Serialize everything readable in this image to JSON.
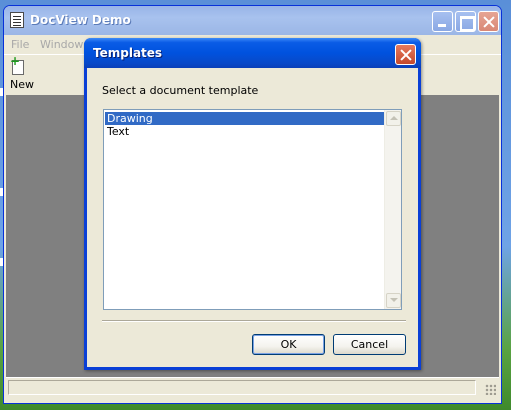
{
  "window": {
    "title": "DocView Demo",
    "controls": [
      "minimize-icon",
      "maximize-icon",
      "close-icon"
    ]
  },
  "menubar": {
    "items": [
      "File",
      "Window"
    ]
  },
  "toolbar": {
    "new_label": "New",
    "new_icon": "new-document-icon"
  },
  "dialog": {
    "title": "Templates",
    "prompt": "Select a document template",
    "templates": [
      {
        "label": "Drawing",
        "selected": true
      },
      {
        "label": "Text",
        "selected": false
      }
    ],
    "ok_label": "OK",
    "cancel_label": "Cancel"
  },
  "colors": {
    "selection": "#316ac5",
    "dialog_title": "#0052de",
    "client_area": "#808080"
  }
}
